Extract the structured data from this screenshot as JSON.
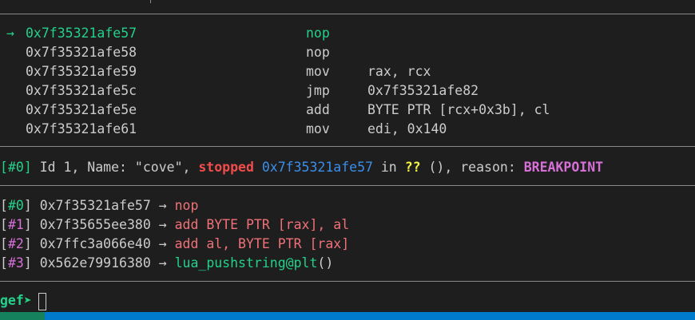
{
  "code": {
    "current_marker": "→",
    "lines": [
      {
        "addr": "0x7f35321afe57",
        "mnemonic": "nop",
        "operands": ""
      },
      {
        "addr": "0x7f35321afe58",
        "mnemonic": "nop",
        "operands": ""
      },
      {
        "addr": "0x7f35321afe59",
        "mnemonic": "mov",
        "operands": "rax, rcx"
      },
      {
        "addr": "0x7f35321afe5c",
        "mnemonic": "jmp",
        "operands": "0x7f35321afe82"
      },
      {
        "addr": "0x7f35321afe5e",
        "mnemonic": "add",
        "operands": "BYTE PTR [rcx+0x3b], cl"
      },
      {
        "addr": "0x7f35321afe61",
        "mnemonic": "mov",
        "operands": "edi, 0x140"
      }
    ]
  },
  "threads": {
    "index": "#0",
    "prefix": "Id 1, Name: \"cove\",",
    "state": "stopped",
    "addr": "0x7f35321afe57",
    "in_text": "in",
    "func": "??",
    "args_text": "(), reason:",
    "reason": "BREAKPOINT"
  },
  "trace": [
    {
      "index": "#0",
      "addr": "0x7f35321afe57",
      "arrow": "→",
      "insn": "nop",
      "style": "salmon"
    },
    {
      "index": "#1",
      "addr": "0x7f35655ee380",
      "arrow": "→",
      "insn": "add BYTE PTR [rax], al",
      "style": "salmon"
    },
    {
      "index": "#2",
      "addr": "0x7ffc3a066e40",
      "arrow": "→",
      "insn": "add al, BYTE PTR [rax]",
      "style": "salmon"
    },
    {
      "index": "#3",
      "addr": "0x562e79916380",
      "arrow": "→",
      "insn": "lua_pushstring@plt",
      "suffix": "()",
      "style": "green"
    }
  ],
  "prompt": {
    "text": "gef➤"
  },
  "colors": {
    "background": "#1e1e1e",
    "green": "#23d18b",
    "pink": "#d670d6",
    "red": "#f14c4c",
    "blue": "#3b8eea",
    "yellow": "#f5f543",
    "statusbar": "#007acc"
  }
}
